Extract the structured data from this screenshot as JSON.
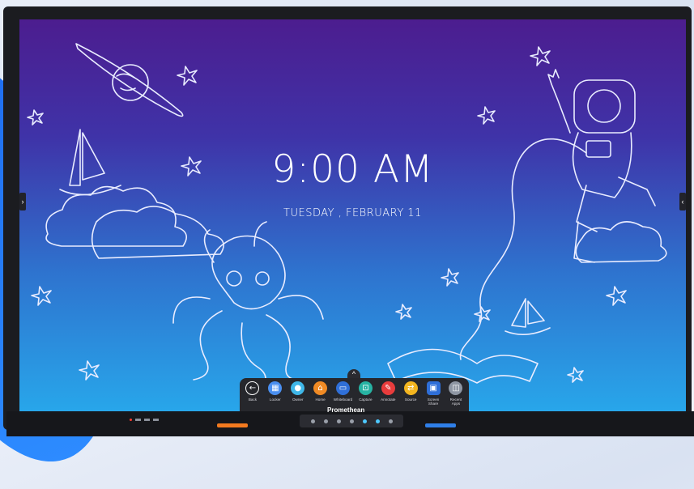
{
  "screen": {
    "time": "9:00 AM",
    "date": "TUESDAY , FEBRUARY 11"
  },
  "edges": {
    "left_icon": "chevron-right-icon",
    "right_icon": "chevron-left-icon"
  },
  "dock": {
    "handle_icon": "chevron-up-icon",
    "items": [
      {
        "label": "Back",
        "icon": "back-arrow-icon",
        "color": "#26272c"
      },
      {
        "label": "Locker",
        "icon": "locker-icon",
        "color": "#4a8ff0"
      },
      {
        "label": "Owner",
        "icon": "user-icon",
        "color": "#3fb7e8"
      },
      {
        "label": "Home",
        "icon": "home-icon",
        "color": "#f08a24"
      },
      {
        "label": "Whiteboard",
        "icon": "whiteboard-icon",
        "color": "#2f6fd8"
      },
      {
        "label": "Capture",
        "icon": "capture-icon",
        "color": "#27b3a3"
      },
      {
        "label": "Annotate",
        "icon": "pen-icon",
        "color": "#e83c3c"
      },
      {
        "label": "Source",
        "icon": "source-icon",
        "color": "#f3b51f"
      },
      {
        "label": "Screen Share",
        "icon": "screen-share-icon",
        "color": "#2f6fd8"
      },
      {
        "label": "Recent Apps",
        "icon": "recent-apps-icon",
        "color": "#8e96a3"
      }
    ]
  },
  "bezel": {
    "brand": "Promethean"
  }
}
